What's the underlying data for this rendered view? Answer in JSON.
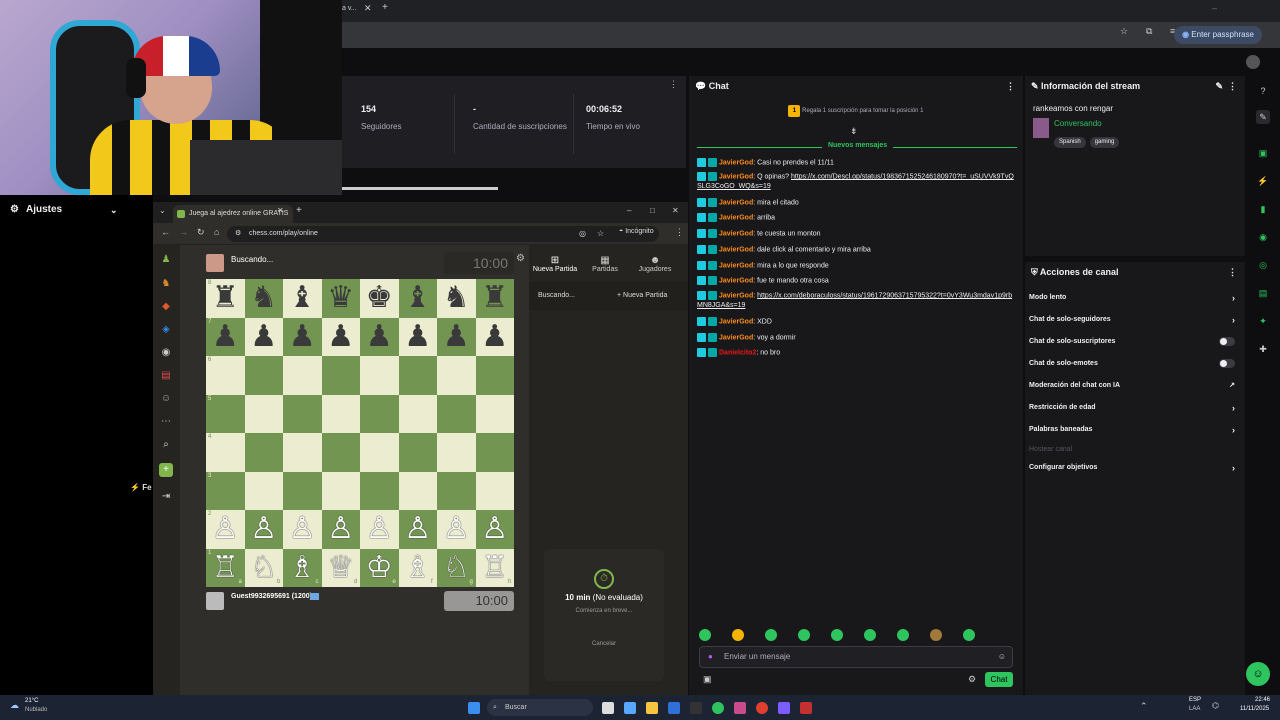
{
  "browser": {
    "passphrase_label": "Enter passphrase",
    "tab_partial": "a v..."
  },
  "stats": [
    {
      "value": "154",
      "label": "Seguidores"
    },
    {
      "value": "-",
      "label": "Cantidad de suscripciones"
    },
    {
      "value": "00:06:52",
      "label": "Tiempo en vivo"
    }
  ],
  "left": {
    "settings_label": "Ajustes",
    "partial_label": "Fe"
  },
  "chess": {
    "tab_title": "Juega al ajedrez online GRATIS",
    "url": "chess.com/play/online",
    "incognito": "Incógnito",
    "opponent_name": "Buscando...",
    "opponent_clock": "10:00",
    "player_name": "Guest9932695691 (1200)",
    "player_clock": "10:00",
    "tabs": [
      "Nueva Partida",
      "Partidas",
      "Jugadores"
    ],
    "searching": "Buscando...",
    "new_game": "Nueva Partida",
    "time_control": "10 min",
    "rated": "(No evaluada)",
    "starting": "Comienza en breve...",
    "cancel": "Cancelar",
    "ranks": [
      "8",
      "7",
      "6",
      "5",
      "4",
      "3",
      "2",
      "1"
    ],
    "files": [
      "a",
      "b",
      "c",
      "d",
      "e",
      "f",
      "g",
      "h"
    ],
    "black_back": [
      "♜",
      "♞",
      "♝",
      "♛",
      "♚",
      "♝",
      "♞",
      "♜"
    ],
    "black_pawn": "♟",
    "white_back": [
      "♖",
      "♘",
      "♗",
      "♕",
      "♔",
      "♗",
      "♘",
      "♖"
    ],
    "white_pawn": "♙"
  },
  "chat": {
    "title": "Chat",
    "gift_text": "Regala 1 suscripción para tomar la posición 1",
    "new_messages": "Nuevos mensajes",
    "messages": [
      {
        "user": "JavierGod",
        "text": ": Casi no prendes el 11/11",
        "link": ""
      },
      {
        "user": "JavierGod",
        "text": ": Q opinas? ",
        "link": "https://x.com/Descl.op/status/1983671525246180970?t=_uSUVVk9TvQSLG3CoGO_WQ&s=19"
      },
      {
        "user": "JavierGod",
        "text": ": mira el citado",
        "link": ""
      },
      {
        "user": "JavierGod",
        "text": ": arriba",
        "link": ""
      },
      {
        "user": "JavierGod",
        "text": ": te cuesta un monton",
        "link": ""
      },
      {
        "user": "JavierGod",
        "text": ": dale click al comentario y mira arriba",
        "link": ""
      },
      {
        "user": "JavierGod",
        "text": ": mira a lo que responde",
        "link": ""
      },
      {
        "user": "JavierGod",
        "text": ": fue te mando otra cosa",
        "link": ""
      },
      {
        "user": "JavierGod",
        "text": ": ",
        "link": "https://x.com/deboraculoss/status/1961729063715795322?t=0vY3Wu3mdav1p9rbMN8JGA&s=19"
      },
      {
        "user": "JavierGod",
        "text": ": XDD",
        "link": ""
      },
      {
        "user": "JavierGod",
        "text": ": voy a dormir",
        "link": ""
      },
      {
        "user": "Danielcito2",
        "text": ": no bro",
        "link": ""
      }
    ],
    "input_placeholder": "Enviar un mensaje",
    "send_label": "Chat"
  },
  "info": {
    "title": "Información del stream",
    "stream_title": "rankeamos con rengar",
    "category": "Conversando",
    "tags": [
      "Spanish",
      "gaming"
    ]
  },
  "actions": {
    "title": "Acciones de canal",
    "items": [
      {
        "label": "Modo lento",
        "control": "chevron"
      },
      {
        "label": "Chat de solo-seguidores",
        "control": "chevron"
      },
      {
        "label": "Chat de solo-suscriptores",
        "control": "toggle"
      },
      {
        "label": "Chat de solo-emotes",
        "control": "toggle"
      },
      {
        "label": "Moderación del chat con IA",
        "control": "external"
      },
      {
        "label": "Restricción de edad",
        "control": "chevron"
      },
      {
        "label": "Palabras baneadas",
        "control": "chevron"
      },
      {
        "label": "Hostear canal",
        "control": "disabled"
      },
      {
        "label": "Configurar objetivos",
        "control": "chevron"
      }
    ]
  },
  "taskbar": {
    "weather_temp": "21°C",
    "weather_desc": "Nublado",
    "search_placeholder": "Buscar",
    "lang": "ESP",
    "lang_sub": "LAA",
    "time": "22:46",
    "date": "11/11/2025"
  },
  "colors": {
    "accent": "#2ec55e",
    "board_dark": "#739552",
    "board_light": "#ebecd0",
    "chat_user": "#ff8c1a"
  }
}
